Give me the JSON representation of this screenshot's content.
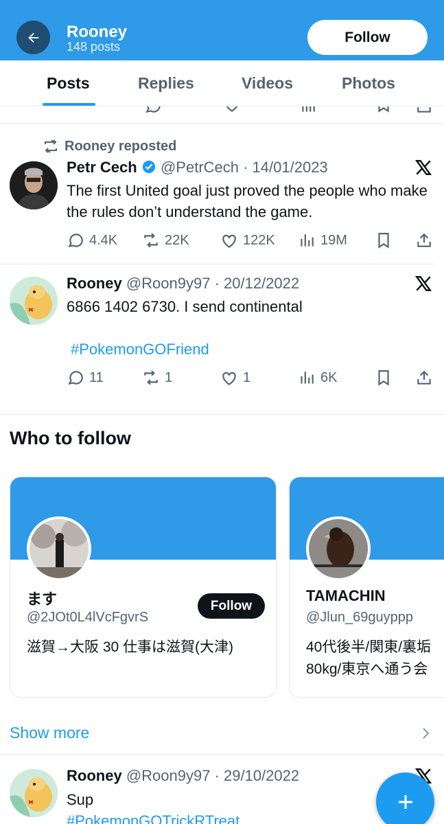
{
  "header": {
    "name": "Rooney",
    "post_count": "148 posts",
    "follow_label": "Follow"
  },
  "tabs": [
    {
      "label": "Posts",
      "active": true
    },
    {
      "label": "Replies",
      "active": false
    },
    {
      "label": "Videos",
      "active": false
    },
    {
      "label": "Photos",
      "active": false
    }
  ],
  "posts": [
    {
      "repost_label": "Rooney reposted",
      "name": "Petr Cech",
      "verified": true,
      "meta": "@PetrCech · 14/01/2023",
      "text": "The first United goal just proved the people who make the rules don’t understand the game.",
      "replies": "4.4K",
      "reposts": "22K",
      "likes": "122K",
      "views": "19M"
    },
    {
      "name": "Rooney",
      "meta": "@Roon9y97 · 20/12/2022",
      "text": "6866 1402 6730. I send continental",
      "hashtag": "#PokemonGOFriend",
      "replies": "11",
      "reposts": "1",
      "likes": "1",
      "views": "6K"
    },
    {
      "name": "Rooney",
      "meta": "@Roon9y97 · 29/10/2022",
      "text": "Sup",
      "hashtag": "#PokemonGOTrickRTreat"
    }
  ],
  "who_to_follow": {
    "title": "Who to follow",
    "cards": [
      {
        "name": "ます",
        "handle": "@2JOt0L4lVcFgvrS",
        "bio": "滋賀→大阪 30 仕事は滋賀(大津)",
        "follow_label": "Follow"
      },
      {
        "name": "TAMACHIN",
        "handle": "@Jlun_69guyppp",
        "bio": "40代後半/関東/裏垢 80kg/東京へ通う会"
      }
    ],
    "show_more": "Show more"
  },
  "colors": {
    "header_bg": "#2e9ae8",
    "accent": "#1d9bf0",
    "muted": "#536471"
  }
}
